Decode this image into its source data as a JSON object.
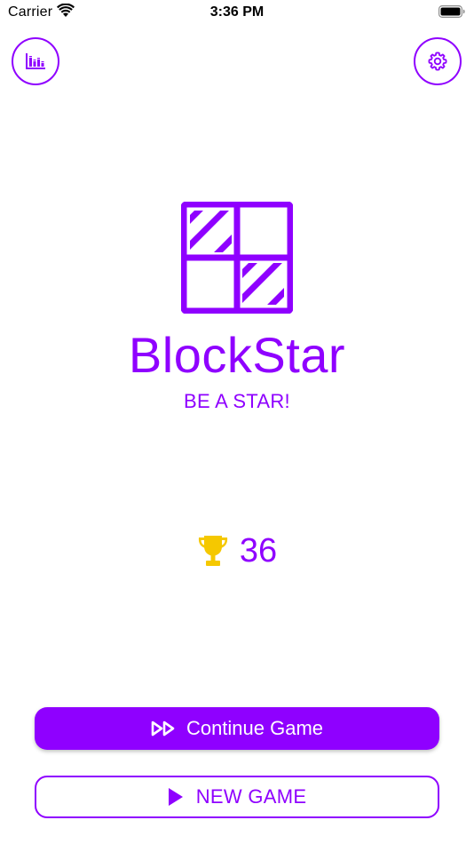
{
  "colors": {
    "brand": "#8F00FF",
    "trophy": "#F5C800",
    "background": "#FFFFFF"
  },
  "status_bar": {
    "carrier": "Carrier",
    "time": "3:36 PM",
    "icons": [
      "wifi-icon",
      "battery-icon"
    ]
  },
  "toolbar": {
    "left_icon": "stats-icon",
    "right_icon": "gear-icon"
  },
  "app": {
    "title": "BlockStar",
    "tagline": "BE A STAR!",
    "logo_icon": "blockstar-logo"
  },
  "best_score": {
    "icon": "trophy-icon",
    "value": "36"
  },
  "actions": {
    "continue_label": "Continue Game",
    "continue_icon": "fast-forward-icon",
    "new_game_label": "NEW GAME",
    "new_game_icon": "play-icon"
  }
}
